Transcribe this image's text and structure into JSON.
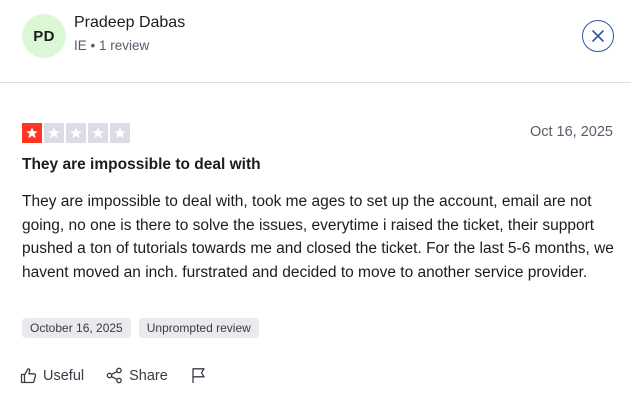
{
  "reviewer": {
    "initials": "PD",
    "name": "Pradeep Dabas",
    "meta": "IE • 1 review"
  },
  "review": {
    "rating": 1,
    "max_rating": 5,
    "date": "Oct 16, 2025",
    "title": "They are impossible to deal with",
    "body": "They are impossible to deal with, took me ages to set up the account, email are not going, no one is there to solve the issues, everytime i raised the ticket, their support pushed a ton of tutorials towards me and closed the ticket. For the last 5-6 months, we havent moved an inch. furstrated and decided to move to another service provider.",
    "tags": [
      "October 16, 2025",
      "Unprompted review"
    ]
  },
  "actions": {
    "useful_label": "Useful",
    "share_label": "Share"
  },
  "icons": {
    "close": "close-icon",
    "star": "star-icon",
    "useful": "thumbs-up-icon",
    "share": "share-icon",
    "flag": "flag-icon"
  },
  "colors": {
    "star_filled": "#ff3722",
    "star_empty": "#dcdce6",
    "avatar_bg": "#dcf7d6",
    "close_border": "#2f55a4"
  }
}
